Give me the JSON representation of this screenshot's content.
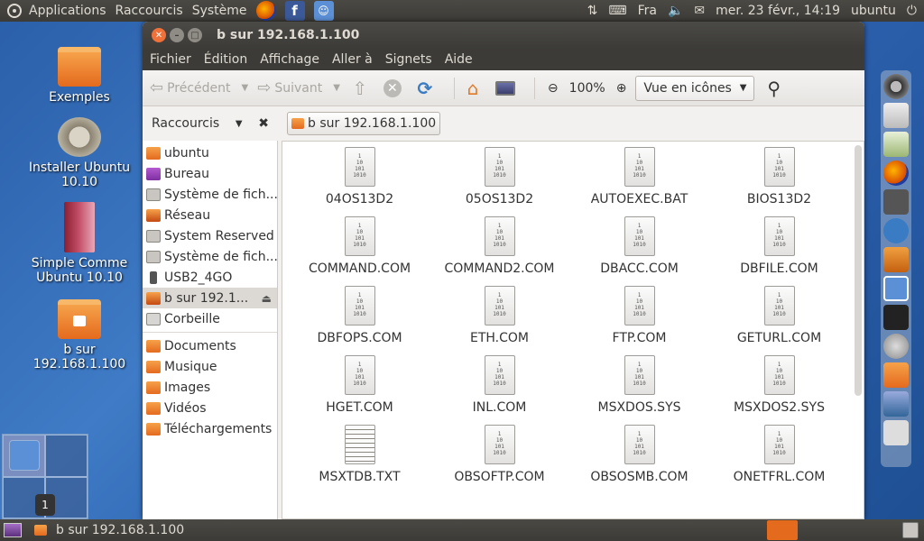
{
  "top_panel": {
    "menus": [
      "Applications",
      "Raccourcis",
      "Système"
    ],
    "launchers": [
      "firefox-icon",
      "facebook-icon",
      "finder-icon"
    ],
    "keyboard_layout": "Fra",
    "datetime": "mer. 23 févr., 14:19",
    "user": "ubuntu"
  },
  "desktop_icons": [
    {
      "label": "Exemples"
    },
    {
      "label": "Installer Ubuntu 10.10"
    },
    {
      "label": "Simple Comme Ubuntu 10.10"
    },
    {
      "label": "b sur 192.168.1.100"
    }
  ],
  "workspace": {
    "number": "1"
  },
  "window": {
    "title": "b sur 192.168.1.100",
    "menu": [
      "Fichier",
      "Édition",
      "Affichage",
      "Aller à",
      "Signets",
      "Aide"
    ],
    "toolbar": {
      "back": "Précédent",
      "forward": "Suivant",
      "zoom": "100%",
      "view_mode": "Vue en icônes"
    },
    "sidebar_header": "Raccourcis",
    "location": "b sur 192.168.1.100",
    "places": [
      {
        "label": "ubuntu",
        "icon": "home-folder-icon"
      },
      {
        "label": "Bureau",
        "icon": "desktop-icon"
      },
      {
        "label": "Système de fich...",
        "icon": "drive-icon"
      },
      {
        "label": "Réseau",
        "icon": "network-icon"
      },
      {
        "label": "System Reserved",
        "icon": "drive-icon"
      },
      {
        "label": "Système de fich...",
        "icon": "drive-icon"
      },
      {
        "label": "USB2_4GO",
        "icon": "usb-icon"
      },
      {
        "label": "b sur 192.1...",
        "icon": "network-folder-icon",
        "active": true
      },
      {
        "label": "Corbeille",
        "icon": "trash-icon"
      }
    ],
    "bookmarks": [
      {
        "label": "Documents",
        "icon": "folder-icon"
      },
      {
        "label": "Musique",
        "icon": "music-folder-icon"
      },
      {
        "label": "Images",
        "icon": "pictures-folder-icon"
      },
      {
        "label": "Vidéos",
        "icon": "videos-folder-icon"
      },
      {
        "label": "Téléchargements",
        "icon": "downloads-folder-icon"
      }
    ],
    "files": [
      {
        "name": "04OS13D2",
        "type": "binary"
      },
      {
        "name": "05OS13D2",
        "type": "binary"
      },
      {
        "name": "AUTOEXEC.BAT",
        "type": "binary"
      },
      {
        "name": "BIOS13D2",
        "type": "binary"
      },
      {
        "name": "COMMAND.COM",
        "type": "binary"
      },
      {
        "name": "COMMAND2.COM",
        "type": "binary"
      },
      {
        "name": "DBACC.COM",
        "type": "binary"
      },
      {
        "name": "DBFILE.COM",
        "type": "binary"
      },
      {
        "name": "DBFOPS.COM",
        "type": "binary"
      },
      {
        "name": "ETH.COM",
        "type": "binary"
      },
      {
        "name": "FTP.COM",
        "type": "binary"
      },
      {
        "name": "GETURL.COM",
        "type": "binary"
      },
      {
        "name": "HGET.COM",
        "type": "binary"
      },
      {
        "name": "INL.COM",
        "type": "binary"
      },
      {
        "name": "MSXDOS.SYS",
        "type": "binary"
      },
      {
        "name": "MSXDOS2.SYS",
        "type": "binary"
      },
      {
        "name": "MSXTDB.TXT",
        "type": "text"
      },
      {
        "name": "OBSOFTP.COM",
        "type": "binary"
      },
      {
        "name": "OBSOSMB.COM",
        "type": "binary"
      },
      {
        "name": "ONETFRL.COM",
        "type": "binary"
      }
    ],
    "binary_glyph": [
      "1",
      "10",
      "101",
      "1010"
    ]
  },
  "bottom_panel": {
    "task_label": "b sur 192.168.1.100"
  }
}
